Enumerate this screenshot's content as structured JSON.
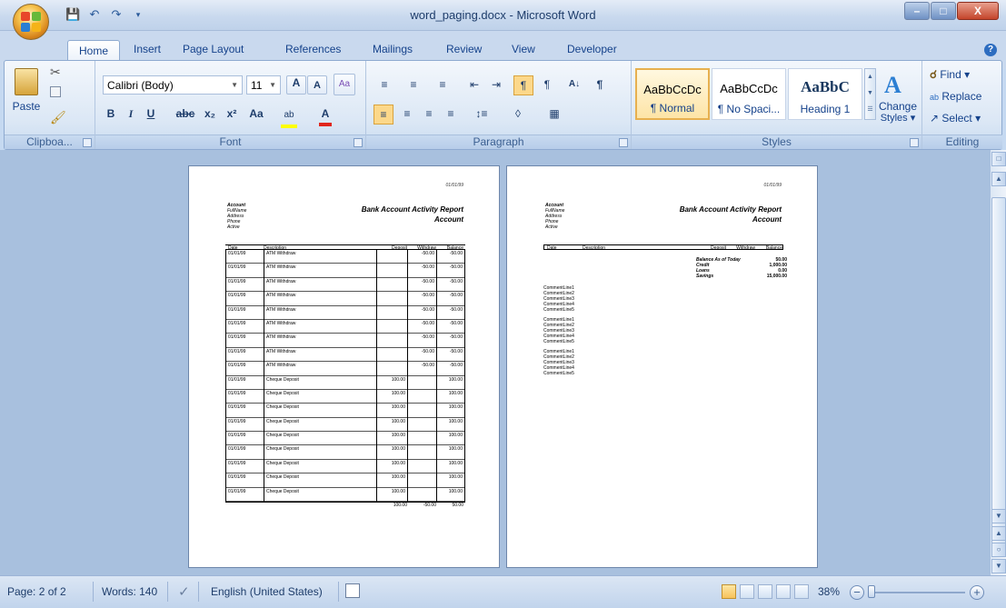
{
  "window": {
    "title": "word_paging.docx - Microsoft Word"
  },
  "colors": {
    "ribbon_bg": "#dbe7f5",
    "doc_bg": "#a8c0de",
    "accent": "#15428b",
    "selected_style": "#fde4a6"
  },
  "tabs": [
    {
      "label": "Home"
    },
    {
      "label": "Insert"
    },
    {
      "label": "Page Layout"
    },
    {
      "label": "References"
    },
    {
      "label": "Mailings"
    },
    {
      "label": "Review"
    },
    {
      "label": "View"
    },
    {
      "label": "Developer"
    }
  ],
  "ribbon": {
    "clipboard": {
      "paste_label": "Paste",
      "group_label": "Clipboa..."
    },
    "font": {
      "font_name": "Calibri (Body)",
      "font_size": "11",
      "group_label": "Font",
      "bold": "B",
      "italic": "I",
      "underline": "U",
      "strike": "abc",
      "sub": "x₂",
      "sup": "x²",
      "case": "Aa"
    },
    "paragraph": {
      "group_label": "Paragraph"
    },
    "styles": {
      "items": [
        {
          "sample": "AaBbCcDc",
          "name": "¶ Normal"
        },
        {
          "sample": "AaBbCcDc",
          "name": "¶ No Spaci..."
        },
        {
          "sample": "AaBbC",
          "name": "Heading 1"
        }
      ],
      "change_label": "Change",
      "change_label2": "Styles ▾",
      "group_label": "Styles"
    },
    "editing": {
      "find": "Find ▾",
      "replace": "Replace",
      "select": "Select ▾",
      "group_label": "Editing"
    }
  },
  "document": {
    "date": "01/01/99",
    "report_title": "Bank Account Activity Report",
    "report_subtitle": "Account",
    "account_labels": [
      "Account",
      "FullName",
      "Address",
      "Phone",
      "Active"
    ],
    "table_headers": [
      "Date",
      "Description",
      "Deposit",
      "Withdraw",
      "Balance"
    ],
    "rows": [
      {
        "date": "01/01/99",
        "desc": "ATM Withdraw",
        "deposit": "",
        "withdraw": "-50.00",
        "balance": "-50.00"
      },
      {
        "date": "01/01/99",
        "desc": "ATM Withdraw",
        "deposit": "",
        "withdraw": "-50.00",
        "balance": "-50.00"
      },
      {
        "date": "01/01/99",
        "desc": "ATM Withdraw",
        "deposit": "",
        "withdraw": "-50.00",
        "balance": "-50.00"
      },
      {
        "date": "01/01/99",
        "desc": "ATM Withdraw",
        "deposit": "",
        "withdraw": "-50.00",
        "balance": "-50.00"
      },
      {
        "date": "01/01/99",
        "desc": "ATM Withdraw",
        "deposit": "",
        "withdraw": "-50.00",
        "balance": "-50.00"
      },
      {
        "date": "01/01/99",
        "desc": "ATM Withdraw",
        "deposit": "",
        "withdraw": "-50.00",
        "balance": "-50.00"
      },
      {
        "date": "01/01/99",
        "desc": "ATM Withdraw",
        "deposit": "",
        "withdraw": "-50.00",
        "balance": "-50.00"
      },
      {
        "date": "01/01/99",
        "desc": "ATM Withdraw",
        "deposit": "",
        "withdraw": "-50.00",
        "balance": "-50.00"
      },
      {
        "date": "01/01/99",
        "desc": "ATM Withdraw",
        "deposit": "",
        "withdraw": "-50.00",
        "balance": "-50.00"
      },
      {
        "date": "01/01/99",
        "desc": "Cheque Deposit",
        "deposit": "100.00",
        "withdraw": "",
        "balance": "100.00"
      },
      {
        "date": "01/01/99",
        "desc": "Cheque Deposit",
        "deposit": "100.00",
        "withdraw": "",
        "balance": "100.00"
      },
      {
        "date": "01/01/99",
        "desc": "Cheque Deposit",
        "deposit": "100.00",
        "withdraw": "",
        "balance": "100.00"
      },
      {
        "date": "01/01/99",
        "desc": "Cheque Deposit",
        "deposit": "100.00",
        "withdraw": "",
        "balance": "100.00"
      },
      {
        "date": "01/01/99",
        "desc": "Cheque Deposit",
        "deposit": "100.00",
        "withdraw": "",
        "balance": "100.00"
      },
      {
        "date": "01/01/99",
        "desc": "Cheque Deposit",
        "deposit": "100.00",
        "withdraw": "",
        "balance": "100.00"
      },
      {
        "date": "01/01/99",
        "desc": "Cheque Deposit",
        "deposit": "100.00",
        "withdraw": "",
        "balance": "100.00"
      },
      {
        "date": "01/01/99",
        "desc": "Cheque Deposit",
        "deposit": "100.00",
        "withdraw": "",
        "balance": "100.00"
      },
      {
        "date": "01/01/99",
        "desc": "Cheque Deposit",
        "deposit": "100.00",
        "withdraw": "",
        "balance": "100.00"
      }
    ],
    "totals": {
      "deposit": "100.00",
      "withdraw": "-50.00",
      "balance": "50.00"
    },
    "summary": [
      {
        "label": "Balance As of Today",
        "value": "50.00"
      },
      {
        "label": "Credit",
        "value": "1,000.00"
      },
      {
        "label": "Loans",
        "value": "0.00"
      },
      {
        "label": "Savings",
        "value": "15,000.00"
      }
    ],
    "comment_lines": [
      "CommentLine1",
      "CommentLine2",
      "CommentLine3",
      "CommentLine4",
      "CommentLine5"
    ]
  },
  "status": {
    "page": "Page: 2 of 2",
    "words": "Words: 140",
    "language": "English (United States)",
    "zoom": "38%"
  }
}
